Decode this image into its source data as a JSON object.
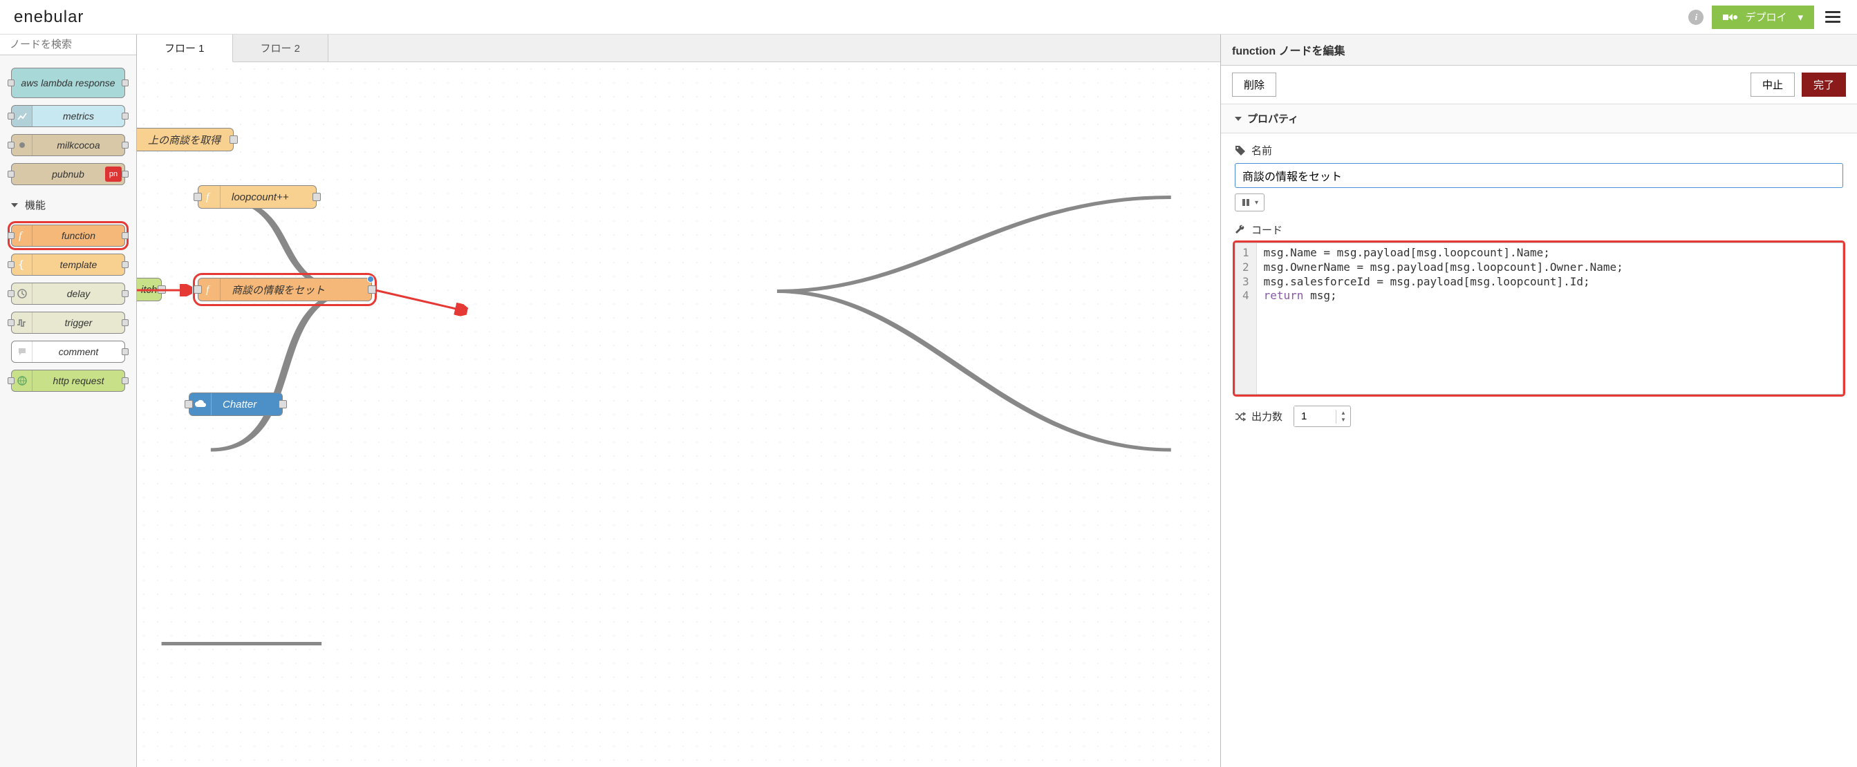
{
  "header": {
    "logo": "enebular",
    "deploy_label": "デプロイ"
  },
  "palette": {
    "search_placeholder": "ノードを検索",
    "category_label": "機能",
    "nodes": [
      {
        "label": "aws lambda response",
        "color": "c-teal",
        "ports": "lr"
      },
      {
        "label": "metrics",
        "color": "c-ltblue",
        "ports": "lr"
      },
      {
        "label": "milkcocoa",
        "color": "c-tan",
        "ports": "lr"
      },
      {
        "label": "pubnub",
        "color": "c-tan",
        "ports": "lr",
        "badge": "pn"
      }
    ],
    "fn_nodes": [
      {
        "label": "function",
        "color": "c-orange-sel",
        "icon": "f",
        "ports": "lr",
        "highlight": true
      },
      {
        "label": "template",
        "color": "c-orange",
        "icon": "{",
        "ports": "lr"
      },
      {
        "label": "delay",
        "color": "c-ltgray",
        "icon": "clock",
        "ports": "lr"
      },
      {
        "label": "trigger",
        "color": "c-ltgray",
        "icon": "pulse",
        "ports": "lr"
      },
      {
        "label": "comment",
        "color": "c-white",
        "icon": "bubble",
        "ports": "r"
      },
      {
        "label": "http request",
        "color": "c-green",
        "icon": "globe",
        "ports": "lr"
      }
    ]
  },
  "workspace": {
    "tabs": [
      {
        "label": "フロー 1",
        "active": true
      },
      {
        "label": "フロー 2",
        "active": false
      }
    ],
    "nodes": {
      "n1": {
        "label": "上の商談を取得"
      },
      "n2": {
        "label": "loopcount++"
      },
      "n3": {
        "label": "itch"
      },
      "n4": {
        "label": "商談の情報をセット"
      },
      "n5": {
        "label": "Chatter"
      }
    }
  },
  "sidepanel": {
    "title": "function ノードを編集",
    "buttons": {
      "delete": "削除",
      "cancel": "中止",
      "done": "完了"
    },
    "section_properties": "プロパティ",
    "name_label": "名前",
    "name_value": "商談の情報をセット",
    "code_label": "コード",
    "code_lines": [
      "msg.Name = msg.payload[msg.loopcount].Name;",
      "msg.OwnerName = msg.payload[msg.loopcount].Owner.Name;",
      "msg.salesforceId = msg.payload[msg.loopcount].Id;",
      "return msg;"
    ],
    "outputs_label": "出力数",
    "outputs_value": "1"
  }
}
